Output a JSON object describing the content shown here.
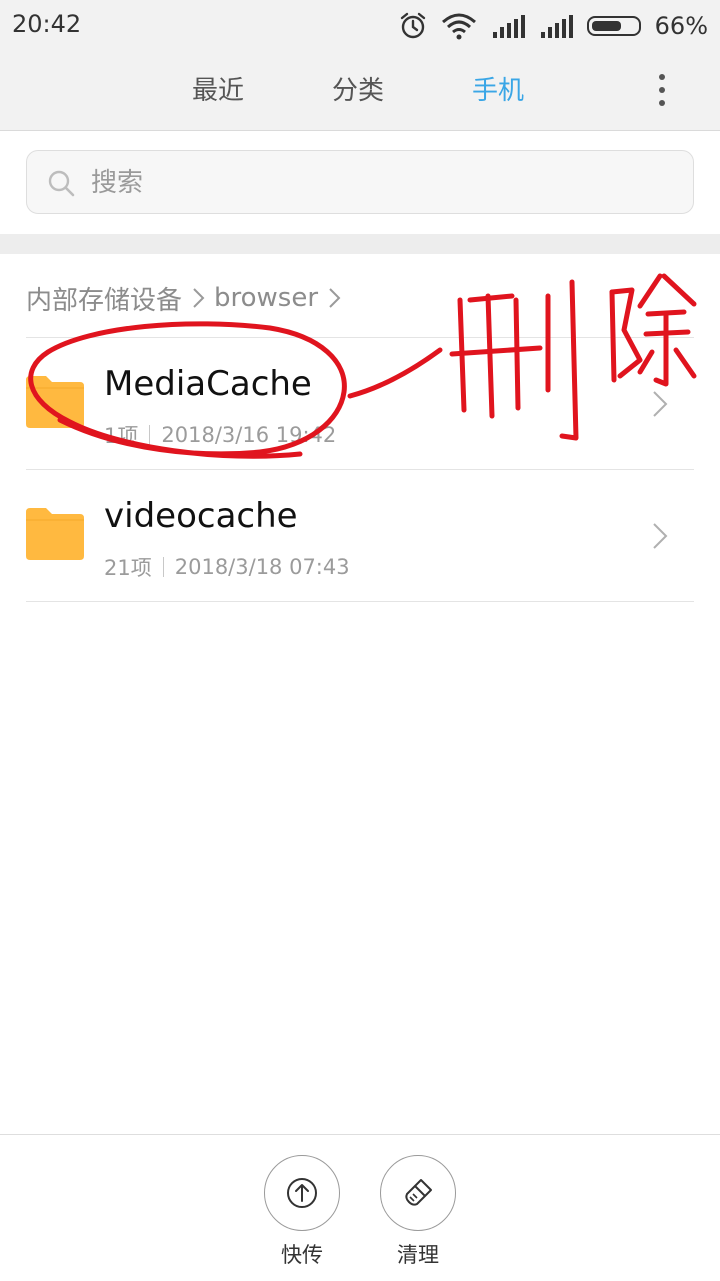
{
  "status_bar": {
    "time": "20:42",
    "battery_text": "66%",
    "battery_level": 0.66
  },
  "tabs": [
    {
      "label": "最近",
      "active": false
    },
    {
      "label": "分类",
      "active": false
    },
    {
      "label": "手机",
      "active": true
    }
  ],
  "search": {
    "placeholder": "搜索",
    "value": ""
  },
  "breadcrumb": [
    "内部存储设备",
    "browser"
  ],
  "files": [
    {
      "name": "MediaCache",
      "count": "1项",
      "date": "2018/3/16 19:42",
      "icon": "folder-icon"
    },
    {
      "name": "videocache",
      "count": "21项",
      "date": "2018/3/18 07:43",
      "icon": "folder-icon"
    }
  ],
  "annotation": {
    "text": "删除",
    "color": "#e0141e"
  },
  "bottom_actions": [
    {
      "label": "快传",
      "icon": "upload-icon"
    },
    {
      "label": "清理",
      "icon": "brush-icon"
    }
  ],
  "colors": {
    "accent": "#3aa6e6",
    "folder": "#ffb940",
    "header_bg": "#f2f2f2"
  }
}
